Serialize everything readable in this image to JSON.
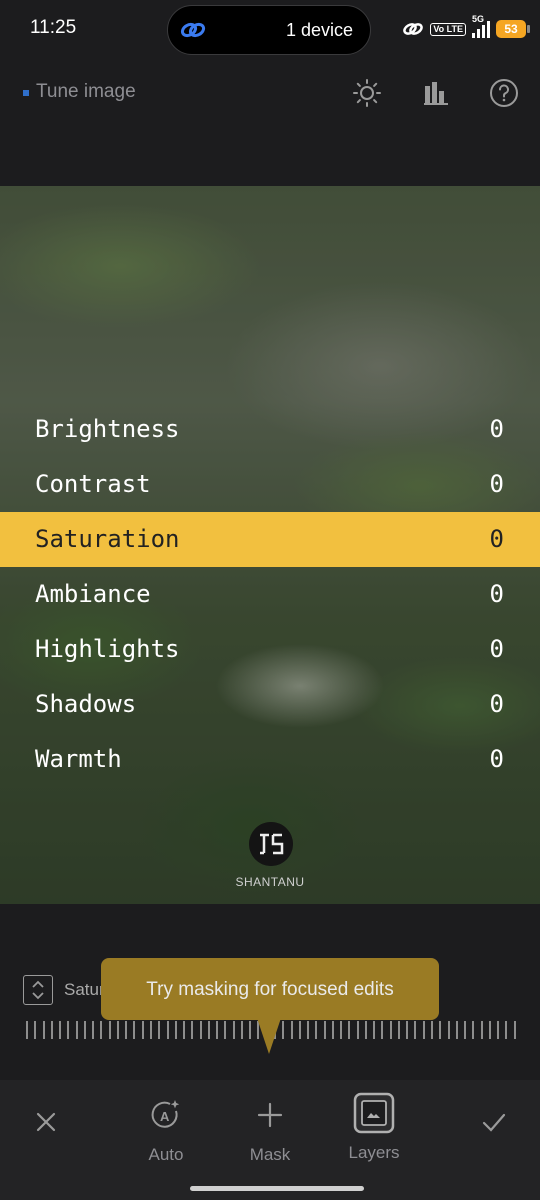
{
  "status_bar": {
    "time": "11:25",
    "device_text": "1 device",
    "net": "5G",
    "volte": "Vo LTE",
    "battery": "53"
  },
  "header": {
    "title": "Tune image"
  },
  "adjustments": [
    {
      "name": "Brightness",
      "value": "0"
    },
    {
      "name": "Contrast",
      "value": "0"
    },
    {
      "name": "Saturation",
      "value": "0"
    },
    {
      "name": "Ambiance",
      "value": "0"
    },
    {
      "name": "Highlights",
      "value": "0"
    },
    {
      "name": "Shadows",
      "value": "0"
    },
    {
      "name": "Warmth",
      "value": "0"
    }
  ],
  "selected_adjustment": "Saturation",
  "watermark": "SHANTANU",
  "slider": {
    "label": "Satur",
    "tooltip": "Try masking for focused edits"
  },
  "bottom_bar": {
    "auto_label": "Auto",
    "mask_label": "Mask",
    "layers_label": "Layers"
  },
  "colors": {
    "accent": "#f2c03f",
    "tooltip": "#9a7b24",
    "background": "#1c1c1e"
  }
}
